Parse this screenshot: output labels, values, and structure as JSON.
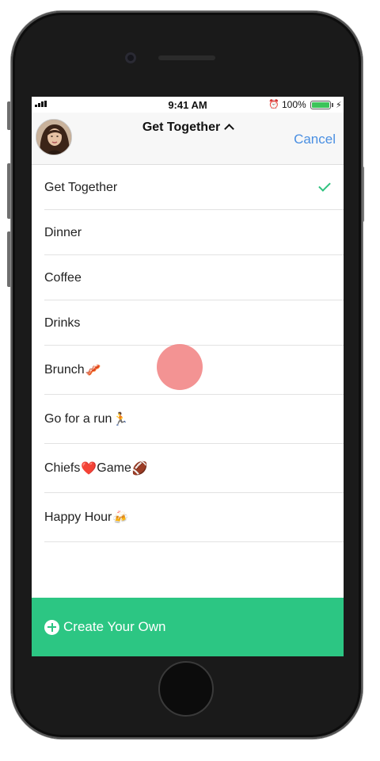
{
  "status_bar": {
    "time": "9:41 AM",
    "battery_percent": "100%",
    "battery_level": 1.0
  },
  "nav": {
    "title": "Get Together",
    "cancel_label": "Cancel"
  },
  "options": [
    {
      "label": "Get Together",
      "emoji": "",
      "selected": true
    },
    {
      "label": "Dinner",
      "emoji": "",
      "selected": false
    },
    {
      "label": "Coffee",
      "emoji": "",
      "selected": false
    },
    {
      "label": "Drinks",
      "emoji": "",
      "selected": false
    },
    {
      "label": "Brunch",
      "emoji": "🥓",
      "selected": false
    },
    {
      "label": "Go for a run",
      "emoji": "🏃",
      "selected": false
    },
    {
      "label": "Chiefs",
      "emoji": "❤️",
      "suffix": "Game",
      "suffix_emoji": "🏈",
      "selected": false
    },
    {
      "label": "Happy Hour",
      "emoji": "🍻",
      "selected": false
    }
  ],
  "create_own": {
    "label": "Create Your Own"
  },
  "colors": {
    "accent_green": "#2cc683",
    "link_blue": "#4a8fe2",
    "tap_indicator": "#f28787"
  }
}
